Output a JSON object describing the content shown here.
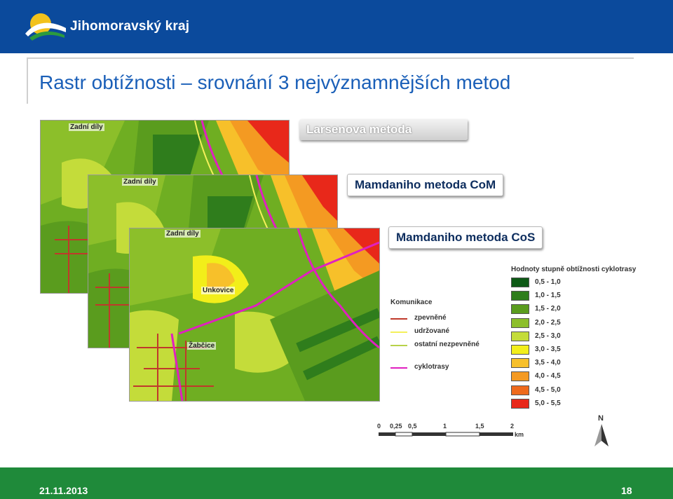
{
  "header": {
    "brand_name": "Jihomoravský kraj"
  },
  "title": "Rastr obtížnosti – srovnání 3 nejvýznamnějších metod",
  "methods": [
    {
      "label": "Larsenova metoda"
    },
    {
      "label": "Mamdaniho metoda CoM"
    },
    {
      "label": "Mamdaniho metoda CoS"
    }
  ],
  "places": {
    "zadni_dily": "Zadní díly",
    "unkovice": "Unkovice",
    "zabcice": "Žabčice"
  },
  "legend": {
    "title": "Hodnoty stupně obtížnosti cyklotrasy",
    "classes": [
      {
        "label": "0,5 - 1,0",
        "color": "#0e5a16"
      },
      {
        "label": "1,0 - 1,5",
        "color": "#2f7d1c"
      },
      {
        "label": "1,5 - 2,0",
        "color": "#5a9c1e"
      },
      {
        "label": "2,0 - 2,5",
        "color": "#8cbf2a"
      },
      {
        "label": "2,5 - 3,0",
        "color": "#c4dc3a"
      },
      {
        "label": "3,0 - 3,5",
        "color": "#f2ee1a"
      },
      {
        "label": "3,5 - 4,0",
        "color": "#f7c02a"
      },
      {
        "label": "4,0 - 4,5",
        "color": "#f49a22"
      },
      {
        "label": "4,5 - 5,0",
        "color": "#ee6a1c"
      },
      {
        "label": "5,0 - 5,5",
        "color": "#e8281a"
      }
    ]
  },
  "roads": {
    "title": "Komunikace",
    "items": [
      {
        "label": "zpevněné",
        "color": "#c0392b"
      },
      {
        "label": "udržované",
        "color": "#f4f05a"
      },
      {
        "label": "ostatní nezpevněné",
        "color": "#b8d24a"
      },
      {
        "label": "cyklotrasy",
        "color": "#e020c0"
      }
    ]
  },
  "scale": {
    "ticks": [
      "0",
      "0,25",
      "0,5",
      "1",
      "1,5",
      "2"
    ],
    "unit": "km"
  },
  "north_label": "N",
  "footer": {
    "date": "21.11.2013",
    "page": "18"
  }
}
